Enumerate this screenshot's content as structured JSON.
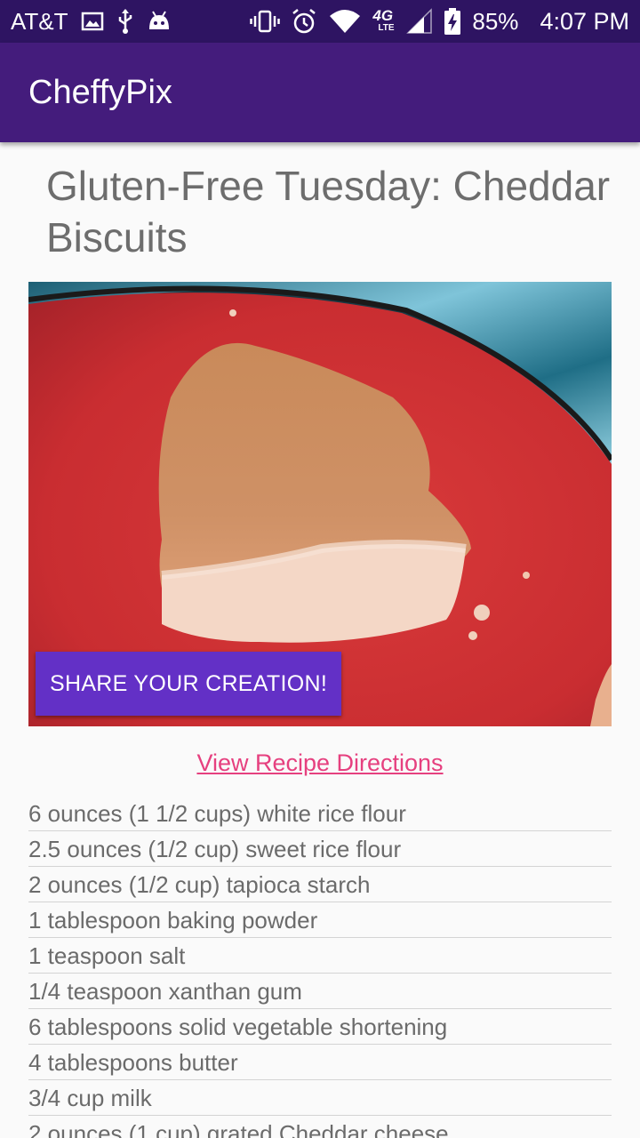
{
  "status_bar": {
    "carrier": "AT&T",
    "network": "4G",
    "network_sub": "LTE",
    "battery": "85%",
    "time": "4:07 PM",
    "icons": [
      "image-icon",
      "usb-icon",
      "android-icon",
      "vibrate-icon",
      "alarm-icon",
      "wifi-icon",
      "signal-icon",
      "battery-charging-icon"
    ]
  },
  "app_bar": {
    "title": "CheffyPix"
  },
  "recipe": {
    "title": "Gluten-Free Tuesday: Cheddar Biscuits",
    "share_label": "SHARE YOUR CREATION!",
    "directions_link": "View Recipe Directions",
    "ingredients": [
      "6 ounces (1 1/2 cups) white rice flour",
      "2.5 ounces (1/2 cup) sweet rice flour",
      "2 ounces (1/2 cup) tapioca starch",
      "1 tablespoon baking powder",
      "1 teaspoon salt",
      "1/4 teaspoon xanthan gum",
      "6 tablespoons solid vegetable shortening",
      "4 tablespoons butter",
      "3/4 cup milk",
      "2 ounces (1 cup) grated Cheddar cheese"
    ]
  },
  "colors": {
    "status_bar": "#2e1462",
    "app_bar": "#441c7c",
    "accent_button": "#6330c6",
    "link": "#e6407f"
  }
}
